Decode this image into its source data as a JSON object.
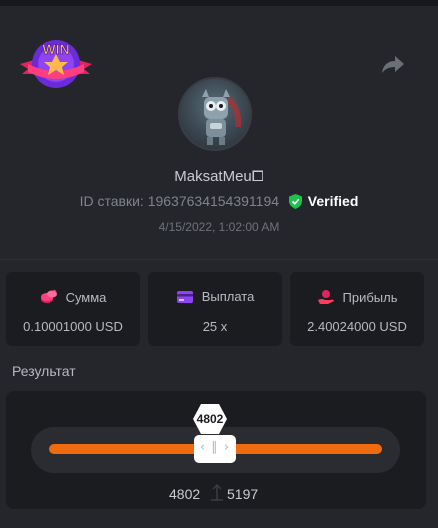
{
  "badge": {
    "text": "WIN"
  },
  "user": {
    "name": "MaksatMeu⧠"
  },
  "bet": {
    "id_label": "ID ставки:",
    "id_value": "19637634154391194",
    "verified_label": "Verified",
    "timestamp": "4/15/2022, 1:02:00 AM"
  },
  "stats": [
    {
      "label": "Сумма",
      "value": "0.10001000 USD",
      "icon": "coins-icon"
    },
    {
      "label": "Выплата",
      "value": "25 x",
      "icon": "card-icon"
    },
    {
      "label": "Прибыль",
      "value": "2.40024000 USD",
      "icon": "profit-hand-icon"
    }
  ],
  "result": {
    "title": "Результат",
    "roll_value": "4802",
    "range_low": "4802",
    "range_high": "5197",
    "handle_glyph": "‹ ∥ ›"
  },
  "colors": {
    "accent_orange": "#f06a0f",
    "verified_green": "#19c44a",
    "card_bg": "#1b1c20",
    "page_bg": "#24262b"
  }
}
